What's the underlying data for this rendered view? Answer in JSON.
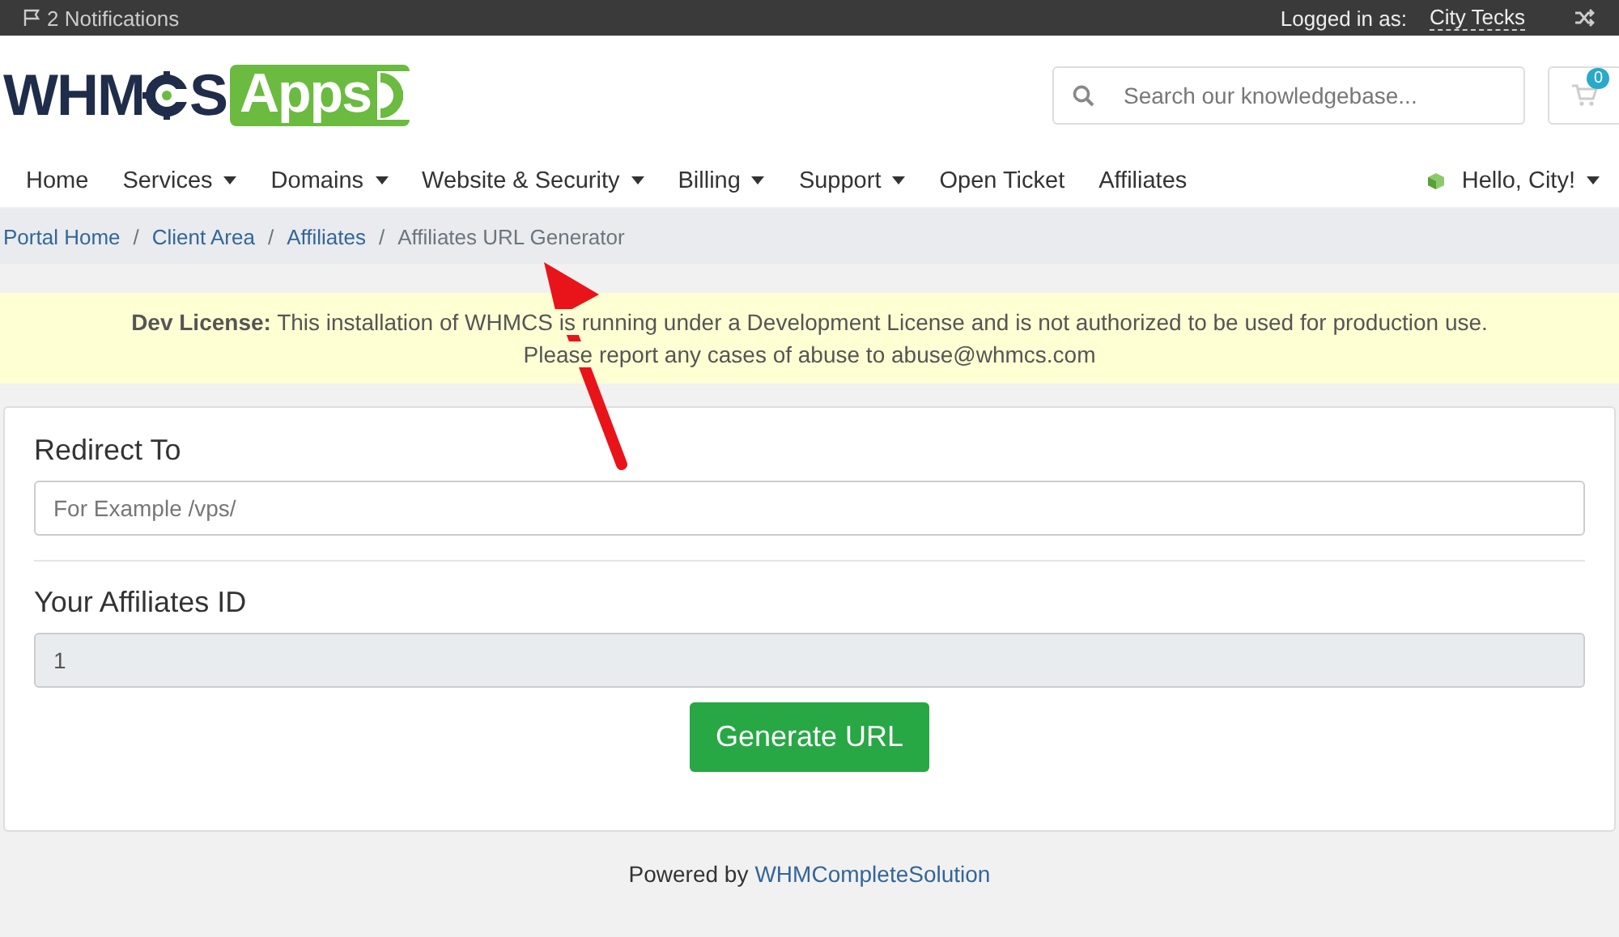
{
  "top_bar": {
    "notifications": "2 Notifications",
    "logged_in_label": "Logged in as:",
    "user": "City Tecks"
  },
  "logo": {
    "left": "WHM",
    "after_gear": "S",
    "badge": "Apps"
  },
  "search": {
    "placeholder": "Search our knowledgebase..."
  },
  "cart": {
    "count": "0"
  },
  "nav": [
    {
      "label": "Home",
      "dropdown": false
    },
    {
      "label": "Services",
      "dropdown": true
    },
    {
      "label": "Domains",
      "dropdown": true
    },
    {
      "label": "Website & Security",
      "dropdown": true
    },
    {
      "label": "Billing",
      "dropdown": true
    },
    {
      "label": "Support",
      "dropdown": true
    },
    {
      "label": "Open Ticket",
      "dropdown": false
    },
    {
      "label": "Affiliates",
      "dropdown": false
    }
  ],
  "account_menu": {
    "label": "Hello, City!"
  },
  "breadcrumb": [
    {
      "label": "Portal Home",
      "current": false
    },
    {
      "separator": "/",
      "label": "Client Area",
      "current": false
    },
    {
      "separator": "/",
      "label": "Affiliates",
      "current": false
    },
    {
      "separator": "/",
      "label": "Affiliates URL Generator",
      "current": true
    }
  ],
  "license_notice": {
    "line_1": "**Dev License:** This installation of WHMCS is running under a Development License and is not authorized to be used for production use.",
    "line_2": "Please report any cases of abuse to abuse@whmcs.com"
  },
  "form": {
    "fields": [
      {
        "label": "Redirect To",
        "placeholder": "For Example /vps/",
        "readonly": false
      },
      {
        "label": "Your Affiliates ID",
        "value": "1",
        "readonly": true
      }
    ],
    "button": "Generate URL"
  },
  "footer": {
    "text": "Powered by",
    "link": "WHMCompleteSolution"
  }
}
